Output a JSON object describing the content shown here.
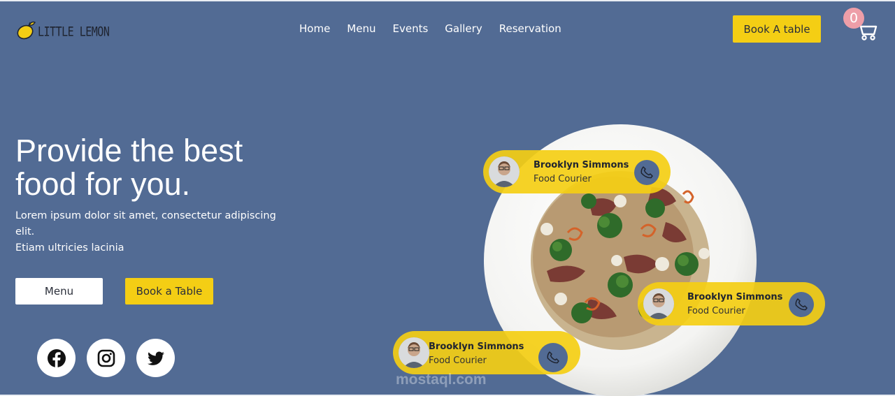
{
  "header": {
    "logo_text": "LITTLE LEMON",
    "nav": [
      "Home",
      "Menu",
      "Events",
      "Gallery",
      "Reservation"
    ],
    "book_button": "Book A table",
    "cart_count": "0"
  },
  "hero": {
    "title": "Provide the best food for you.",
    "description_line1": "Lorem ipsum dolor sit amet, consectetur adipiscing elit.",
    "description_line2": "Etiam ultricies lacinia",
    "menu_button": "Menu",
    "book_button": "Book a Table"
  },
  "social": [
    "facebook-icon",
    "instagram-icon",
    "twitter-icon"
  ],
  "couriers": [
    {
      "name": "Brooklyn Simmons",
      "role": "Food Courier"
    },
    {
      "name": "Brooklyn Simmons",
      "role": "Food Courier"
    },
    {
      "name": "Brooklyn Simmons",
      "role": "Food Courier"
    }
  ],
  "watermark": "mostaql.com",
  "colors": {
    "background": "#526b94",
    "accent": "#f4ce14",
    "badge": "#ee9ea8"
  }
}
